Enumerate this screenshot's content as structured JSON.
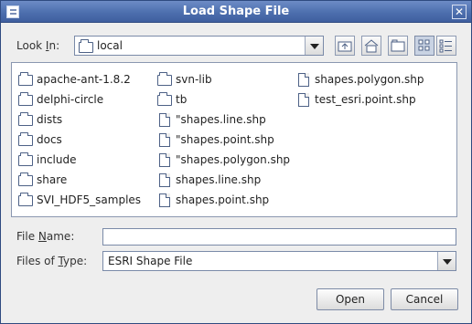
{
  "window": {
    "title": "Load Shape File"
  },
  "look_in": {
    "label_prefix": "Look ",
    "label_mnemonic": "I",
    "label_suffix": "n:",
    "value": "local"
  },
  "toolbar": {
    "up_one_level": "up-folder-icon",
    "home": "home-icon",
    "new_folder": "new-folder-icon",
    "list_view": "list-view-icon",
    "details_view": "details-view-icon"
  },
  "files": [
    {
      "name": "apache-ant-1.8.2",
      "kind": "folder"
    },
    {
      "name": "delphi-circle",
      "kind": "folder"
    },
    {
      "name": "dists",
      "kind": "folder"
    },
    {
      "name": "docs",
      "kind": "folder"
    },
    {
      "name": "include",
      "kind": "folder"
    },
    {
      "name": "share",
      "kind": "folder"
    },
    {
      "name": "SVI_HDF5_samples",
      "kind": "folder"
    },
    {
      "name": "svn-lib",
      "kind": "folder"
    },
    {
      "name": "tb",
      "kind": "folder"
    },
    {
      "name": "\"shapes.line.shp",
      "kind": "file"
    },
    {
      "name": "\"shapes.point.shp",
      "kind": "file"
    },
    {
      "name": "\"shapes.polygon.shp",
      "kind": "file"
    },
    {
      "name": "shapes.line.shp",
      "kind": "file"
    },
    {
      "name": "shapes.point.shp",
      "kind": "file"
    },
    {
      "name": "shapes.polygon.shp",
      "kind": "file"
    },
    {
      "name": "test_esri.point.shp",
      "kind": "file"
    }
  ],
  "file_name": {
    "label_prefix": "File ",
    "label_mnemonic": "N",
    "label_suffix": "ame:",
    "value": ""
  },
  "file_type": {
    "label_prefix": "Files of ",
    "label_mnemonic": "T",
    "label_suffix": "ype:",
    "value": "ESRI Shape File"
  },
  "buttons": {
    "open": "Open",
    "cancel": "Cancel"
  }
}
